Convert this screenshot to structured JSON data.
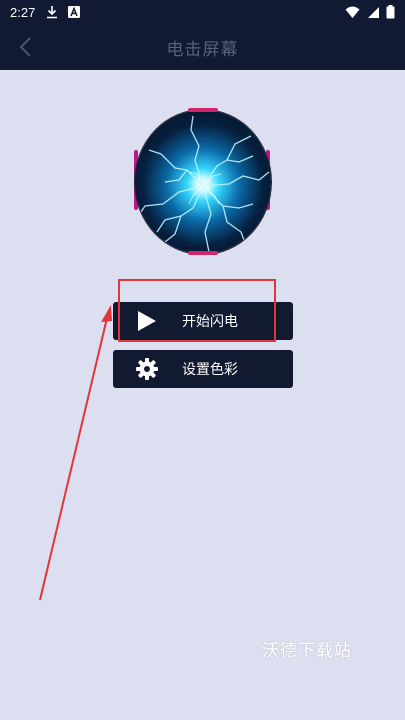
{
  "status_bar": {
    "time": "2:27",
    "icons": [
      "download-icon",
      "a-icon",
      "wifi-icon",
      "signal-icon",
      "battery-icon"
    ]
  },
  "header": {
    "title": "电击屏幕",
    "back_icon": "chevron-left-icon"
  },
  "hero": {
    "image": "lightning-orb"
  },
  "buttons": {
    "start": {
      "label": "开始闪电",
      "icon": "play-icon"
    },
    "color": {
      "label": "设置色彩",
      "icon": "gear-icon"
    }
  },
  "annotation": {
    "color": "#e0353a"
  },
  "watermark": {
    "text": "沃德下载站"
  },
  "colors": {
    "header_bg": "#121a33",
    "page_bg": "#dcdff0",
    "button_bg": "#111a30"
  }
}
